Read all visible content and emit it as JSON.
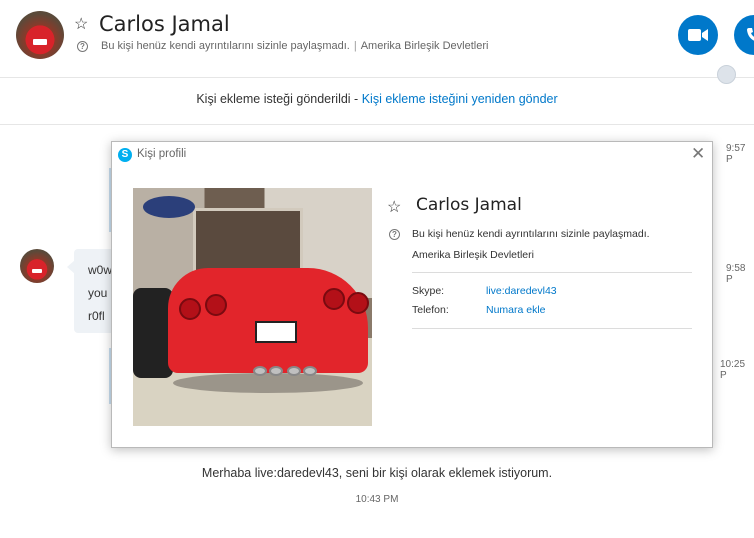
{
  "header": {
    "name": "Carlos Jamal",
    "status": "Bu kişi henüz kendi ayrıntılarını sizinle paylaşmadı.",
    "separator": "|",
    "country": "Amerika Birleşik Devletleri"
  },
  "request_bar": {
    "text": "Kişi ekleme isteği gönderildi -",
    "link": "Kişi ekleme isteğini yeniden gönder"
  },
  "chat": {
    "message_lines": [
      "w0w",
      "you",
      "r0fl"
    ],
    "times": [
      "9:57 P",
      "9:58 P",
      "10:25 P"
    ],
    "sent_message": "Merhaba live:daredevl43, seni bir kişi olarak eklemek istiyorum.",
    "sent_time": "10:43 PM"
  },
  "dialog": {
    "title": "Kişi profili",
    "name": "Carlos Jamal",
    "status": "Bu kişi henüz kendi ayrıntılarını sizinle paylaşmadı.",
    "country": "Amerika Birleşik Devletleri",
    "fields": [
      {
        "label": "Skype:",
        "value": "live:daredevl43"
      },
      {
        "label": "Telefon:",
        "value": "Numara ekle"
      }
    ],
    "close_glyph": "✕"
  },
  "colors": {
    "accent": "#0078ca",
    "skype_logo": "#00aff0",
    "bubble": "#eef2f6"
  },
  "icons": [
    "star-icon",
    "info-icon",
    "video-call-icon",
    "audio-call-icon",
    "globe-icon",
    "skype-logo-icon",
    "close-icon"
  ]
}
